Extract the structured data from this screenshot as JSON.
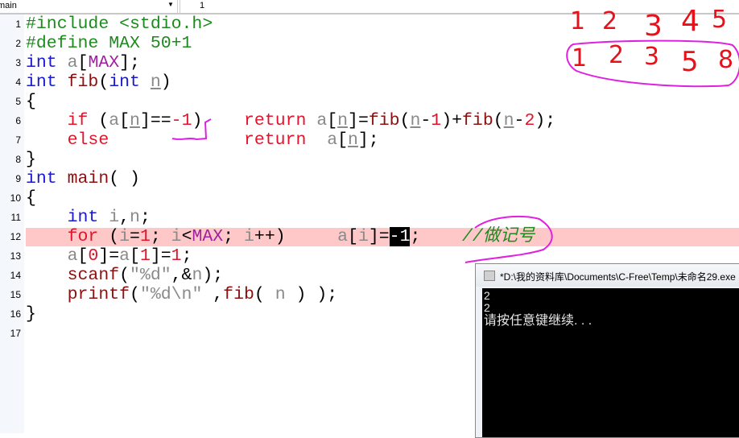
{
  "toolbar": {
    "function_select": "main",
    "line_field": "1"
  },
  "editor": {
    "line_numbers": [
      "1",
      "2",
      "3",
      "4",
      "5",
      "6",
      "7",
      "8",
      "9",
      "10",
      "11",
      "12",
      "13",
      "14",
      "15",
      "16",
      "17"
    ],
    "highlighted_line": 12,
    "lines": [
      [
        [
          "#include <stdio.h>",
          "pp"
        ]
      ],
      [
        [
          "#define MAX 50+1",
          "pp"
        ]
      ],
      [
        [
          "int",
          "kw"
        ],
        [
          " ",
          "op"
        ],
        [
          "a",
          "id"
        ],
        [
          "[",
          "op"
        ],
        [
          "MAX",
          "mac"
        ],
        [
          "];",
          "op"
        ]
      ],
      [
        [
          "int",
          "kw"
        ],
        [
          " ",
          "op"
        ],
        [
          "fib",
          "fn"
        ],
        [
          "(",
          "op"
        ],
        [
          "int",
          "kw"
        ],
        [
          " ",
          "op"
        ],
        [
          "n",
          "id u"
        ],
        [
          ")",
          "op"
        ]
      ],
      [
        [
          "{",
          "op"
        ]
      ],
      [
        [
          "    ",
          "op"
        ],
        [
          "if",
          "ctl"
        ],
        [
          " (",
          "op"
        ],
        [
          "a",
          "id"
        ],
        [
          "[",
          "op"
        ],
        [
          "n",
          "id u"
        ],
        [
          "]==",
          "op"
        ],
        [
          "-1",
          "num"
        ],
        [
          ")    ",
          "op"
        ],
        [
          "return",
          "ctl"
        ],
        [
          " ",
          "op"
        ],
        [
          "a",
          "id"
        ],
        [
          "[",
          "op"
        ],
        [
          "n",
          "id u"
        ],
        [
          "]=",
          "op"
        ],
        [
          "fib",
          "fn"
        ],
        [
          "(",
          "op"
        ],
        [
          "n",
          "id u"
        ],
        [
          "-",
          "op"
        ],
        [
          "1",
          "num"
        ],
        [
          ")+",
          "op"
        ],
        [
          "fib",
          "fn"
        ],
        [
          "(",
          "op"
        ],
        [
          "n",
          "id u"
        ],
        [
          "-",
          "op"
        ],
        [
          "2",
          "num"
        ],
        [
          ");",
          "op"
        ]
      ],
      [
        [
          "    ",
          "op"
        ],
        [
          "else",
          "ctl"
        ],
        [
          "             ",
          "op"
        ],
        [
          "return",
          "ctl"
        ],
        [
          "  ",
          "op"
        ],
        [
          "a",
          "id"
        ],
        [
          "[",
          "op"
        ],
        [
          "n",
          "id u"
        ],
        [
          "];",
          "op"
        ]
      ],
      [
        [
          "}",
          "op"
        ]
      ],
      [
        [
          "int",
          "kw"
        ],
        [
          " ",
          "op"
        ],
        [
          "main",
          "fn"
        ],
        [
          "( )",
          "op"
        ]
      ],
      [
        [
          "{",
          "op"
        ]
      ],
      [
        [
          "    ",
          "op"
        ],
        [
          "int",
          "kw"
        ],
        [
          " ",
          "op"
        ],
        [
          "i",
          "id"
        ],
        [
          ",",
          "op"
        ],
        [
          "n",
          "id"
        ],
        [
          ";",
          "op"
        ]
      ],
      [
        [
          "    ",
          "op"
        ],
        [
          "for",
          "ctl"
        ],
        [
          " (",
          "op"
        ],
        [
          "i",
          "id"
        ],
        [
          "=",
          "op"
        ],
        [
          "1",
          "num"
        ],
        [
          "; ",
          "op"
        ],
        [
          "i",
          "id"
        ],
        [
          "<",
          "op"
        ],
        [
          "MAX",
          "mac"
        ],
        [
          "; ",
          "op"
        ],
        [
          "i",
          "id"
        ],
        [
          "++)     ",
          "op"
        ],
        [
          "a",
          "id"
        ],
        [
          "[",
          "op"
        ],
        [
          "i",
          "id"
        ],
        [
          "]=",
          "op"
        ],
        [
          "-1",
          "num sel"
        ],
        [
          ";",
          "op"
        ],
        [
          "    ",
          "op"
        ],
        [
          "//做记号",
          "cm"
        ]
      ],
      [
        [
          "    ",
          "op"
        ],
        [
          "a",
          "id"
        ],
        [
          "[",
          "op"
        ],
        [
          "0",
          "num"
        ],
        [
          "]=",
          "op"
        ],
        [
          "a",
          "id"
        ],
        [
          "[",
          "op"
        ],
        [
          "1",
          "num"
        ],
        [
          "]=",
          "op"
        ],
        [
          "1",
          "num"
        ],
        [
          ";",
          "op"
        ]
      ],
      [
        [
          "    ",
          "op"
        ],
        [
          "scanf",
          "fn"
        ],
        [
          "(",
          "op"
        ],
        [
          "\"%d\"",
          "str"
        ],
        [
          ",&",
          "op"
        ],
        [
          "n",
          "id"
        ],
        [
          ");",
          "op"
        ]
      ],
      [
        [
          "    ",
          "op"
        ],
        [
          "printf",
          "fn"
        ],
        [
          "(",
          "op"
        ],
        [
          "\"%d\\n\"",
          "str"
        ],
        [
          " ,",
          "op"
        ],
        [
          "fib",
          "fn"
        ],
        [
          "( ",
          "op"
        ],
        [
          "n",
          "id"
        ],
        [
          " ) );",
          "op"
        ]
      ],
      [
        [
          "}",
          "op"
        ]
      ],
      []
    ]
  },
  "console": {
    "title": "*D:\\我的资料库\\Documents\\C-Free\\Temp\\未命名29.exe",
    "output": [
      "2",
      "2",
      "请按任意键继续. . ."
    ]
  },
  "annotations": {
    "row1": [
      "1",
      "2",
      "3",
      "4",
      "5"
    ],
    "row2": [
      "1",
      "2",
      "3",
      "5",
      "8"
    ],
    "ink_colors": {
      "numbers": "#e8101a",
      "circles": "#e020e0"
    }
  }
}
